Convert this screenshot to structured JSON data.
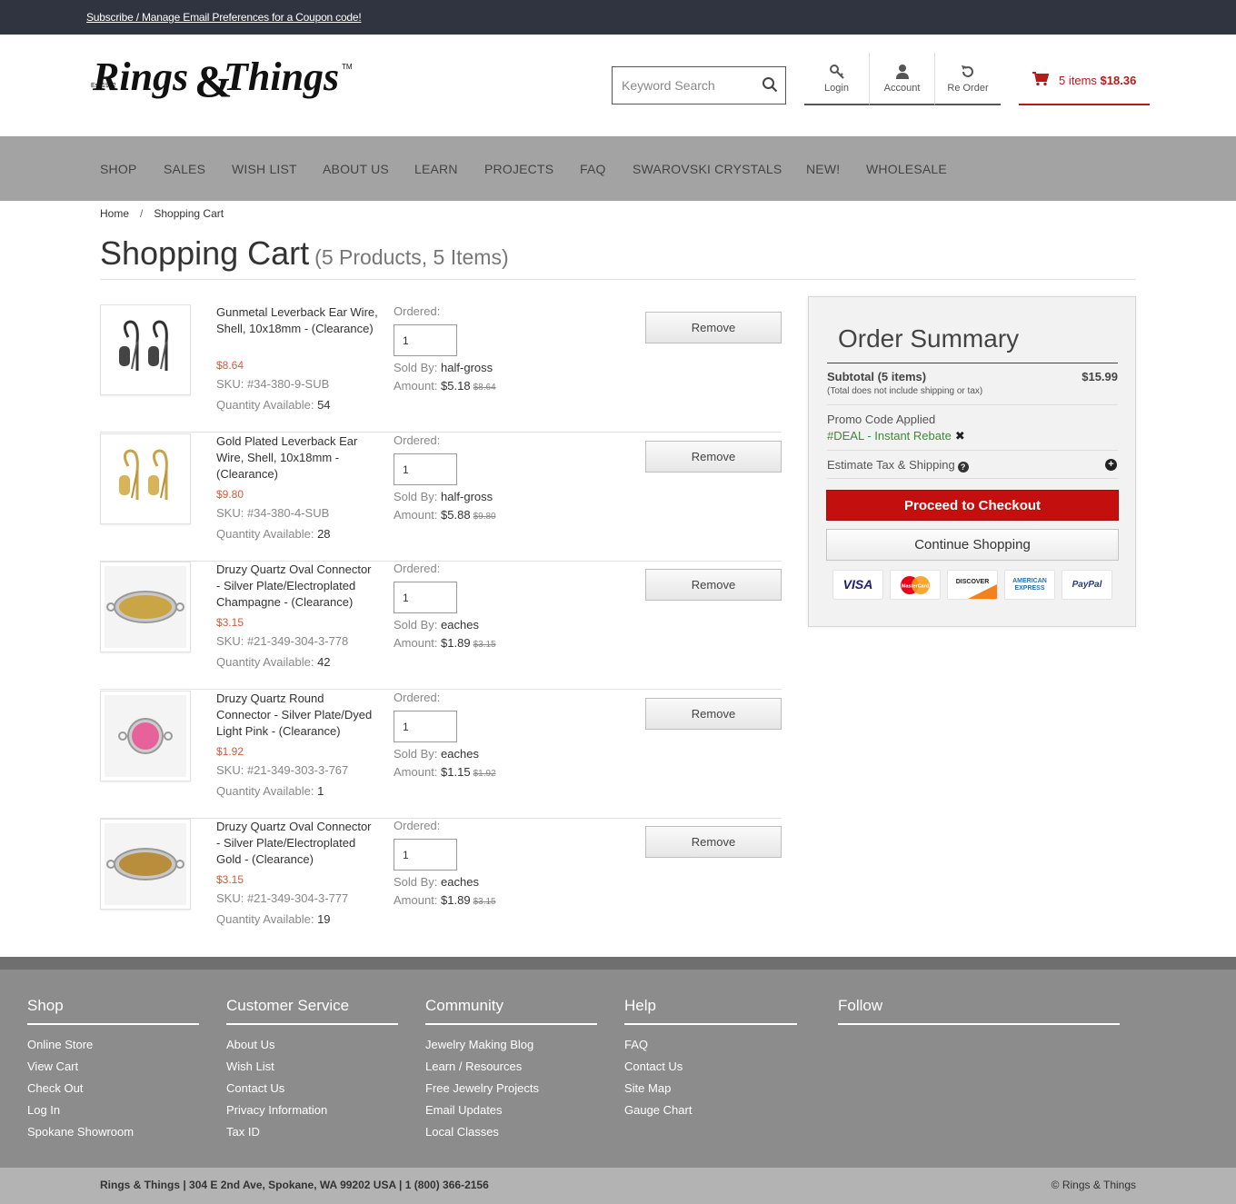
{
  "topbar": {
    "subscribe_link": "Subscribe / Manage Email Preferences for a Coupon code!"
  },
  "header": {
    "logo_text": "Rings&Things",
    "logo_est": "Est.1972",
    "search_placeholder": "Keyword Search",
    "login_label": "Login",
    "account_label": "Account",
    "reorder_label": "Re Order",
    "cart_items": "5 items",
    "cart_total": "$18.36"
  },
  "nav": [
    "SHOP",
    "SALES",
    "WISH LIST",
    "ABOUT US",
    "LEARN",
    "PROJECTS",
    "FAQ",
    "SWAROVSKI CRYSTALS",
    "NEW!",
    "WHOLESALE"
  ],
  "breadcrumb": {
    "home": "Home",
    "separator": "/",
    "current": "Shopping Cart"
  },
  "page": {
    "title": "Shopping Cart",
    "subtitle": "(5 Products, 5 Items)"
  },
  "labels": {
    "ordered": "Ordered:",
    "sold_by": "Sold By:",
    "amount": "Amount:",
    "qty_available": "Quantity Available:",
    "remove": "Remove"
  },
  "cart_items": [
    {
      "name": "Gunmetal Leverback Ear Wire, Shell, 10x18mm - (Clearance)",
      "price": "$8.64",
      "sku": "SKU: #34-380-9-SUB",
      "qty_available": "54",
      "qty": "1",
      "sold_by": "half-gross",
      "amount": "$5.18",
      "amount_old": "$8.64",
      "image": "gunmetal-earwire"
    },
    {
      "name": "Gold Plated Leverback Ear Wire, Shell, 10x18mm - (Clearance)",
      "price": "$9.80",
      "sku": "SKU: #34-380-4-SUB",
      "qty_available": "28",
      "qty": "1",
      "sold_by": "half-gross",
      "amount": "$5.88",
      "amount_old": "$9.80",
      "image": "gold-earwire"
    },
    {
      "name": "Druzy Quartz Oval Connector - Silver Plate/Electroplated Champagne - (Clearance)",
      "price": "$3.15",
      "sku": "SKU: #21-349-304-3-778",
      "qty_available": "42",
      "qty": "1",
      "sold_by": "eaches",
      "amount": "$1.89",
      "amount_old": "$3.15",
      "image": "champagne-oval"
    },
    {
      "name": "Druzy Quartz Round Connector - Silver Plate/Dyed Light Pink - (Clearance)",
      "price": "$1.92",
      "sku": "SKU: #21-349-303-3-767",
      "qty_available": "1",
      "qty": "1",
      "sold_by": "eaches",
      "amount": "$1.15",
      "amount_old": "$1.92",
      "image": "pink-round"
    },
    {
      "name": "Druzy Quartz Oval Connector - Silver Plate/Electroplated Gold - (Clearance)",
      "price": "$3.15",
      "sku": "SKU: #21-349-304-3-777",
      "qty_available": "19",
      "qty": "1",
      "sold_by": "eaches",
      "amount": "$1.89",
      "amount_old": "$3.15",
      "image": "gold-oval"
    }
  ],
  "summary": {
    "title": "Order Summary",
    "subtotal_label": "Subtotal (5 items)",
    "subtotal_value": "$15.99",
    "note": "(Total does not include shipping or tax)",
    "promo_label": "Promo Code Applied",
    "promo_code": "#DEAL - Instant Rebate",
    "estimate_label": "Estimate Tax & Shipping",
    "checkout_button": "Proceed to Checkout",
    "continue_button": "Continue Shopping",
    "cards": [
      "VISA",
      "MasterCard",
      "DISCOVER",
      "AMERICAN EXPRESS",
      "PayPal"
    ]
  },
  "footer": {
    "columns": [
      {
        "title": "Shop",
        "links": [
          "Online Store",
          "View Cart",
          "Check Out",
          "Log In",
          "Spokane Showroom"
        ]
      },
      {
        "title": "Customer Service",
        "links": [
          "About Us",
          "Wish List",
          "Contact Us",
          "Privacy Information",
          "Tax ID"
        ]
      },
      {
        "title": "Community",
        "links": [
          "Jewelry Making Blog",
          "Learn / Resources",
          "Free Jewelry Projects",
          "Email Updates",
          "Local Classes"
        ]
      },
      {
        "title": "Help",
        "links": [
          "FAQ",
          "Contact Us",
          "Site Map",
          "Gauge Chart"
        ]
      },
      {
        "title": "Follow",
        "links": []
      }
    ],
    "address": "Rings & Things | 304 E 2nd Ave, Spokane, WA 99202 USA | 1 (800) 366-2156",
    "copyright": "© Rings & Things"
  },
  "colors": {
    "accent_red": "#c40f0f",
    "price_orange": "#d55a3a",
    "promo_green": "#3a8a3a",
    "nav_gray": "#a3a3a3",
    "footer_gray": "#8c8c8c"
  }
}
